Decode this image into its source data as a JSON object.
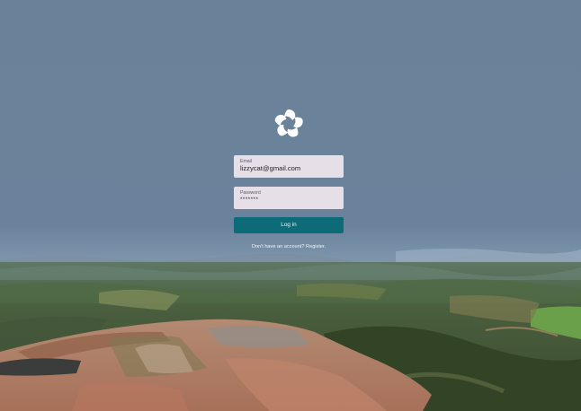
{
  "background": {
    "sky_color": "#69819a",
    "description_icon": "aerial-landscape-mining-site"
  },
  "brand": {
    "logo_icon": "swirl-flower-logo-icon",
    "logo_color": "#ffffff"
  },
  "form": {
    "email_label": "Email",
    "email_value": "lizzycat@gmail.com",
    "password_label": "Password",
    "password_value": "*******",
    "login_button": "Log in",
    "register_prompt": "Don't have an account?",
    "register_link": "Register."
  },
  "colors": {
    "button": "#0d6b78",
    "field_bg": "#e6dfe8"
  }
}
